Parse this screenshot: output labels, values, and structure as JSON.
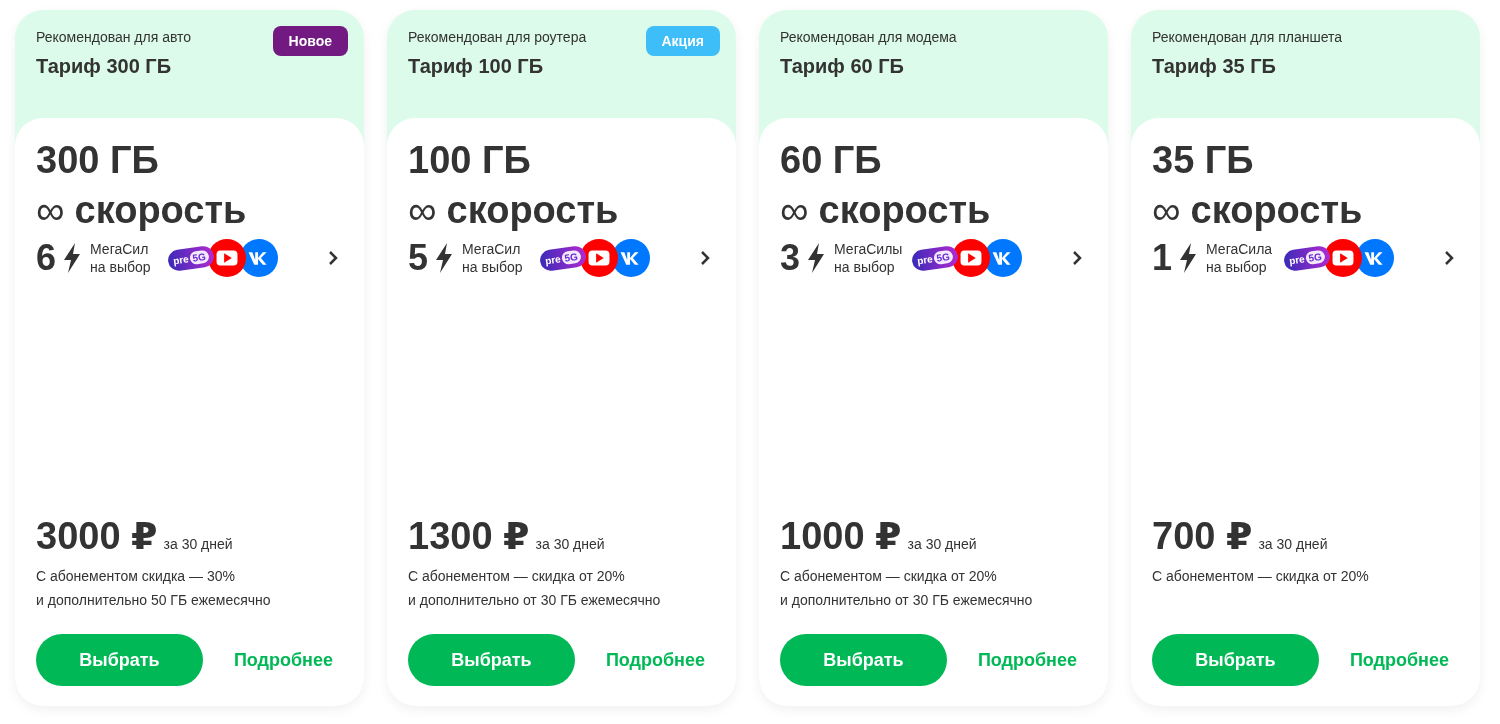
{
  "cards": [
    {
      "recommendation": "Рекомендован для авто",
      "title": "Тариф 300 ГБ",
      "badge": {
        "label": "Новое",
        "color": "#731982"
      },
      "volume": "300 ГБ",
      "infinity": "∞",
      "speed": "скорость",
      "megasily_count": "6",
      "megasily_label": [
        "МегаСил",
        "на выбор"
      ],
      "pill_text": [
        "pre",
        "5G"
      ],
      "price": "3000 ₽",
      "period": "за 30 дней",
      "notes": [
        "С абонементом скидка — 30%",
        "и дополнительно 50 ГБ ежемесячно"
      ],
      "choose": "Выбрать",
      "more": "Подробнее"
    },
    {
      "recommendation": "Рекомендован для роутера",
      "title": "Тариф 100 ГБ",
      "badge": {
        "label": "Акция",
        "color": "#3ebef8"
      },
      "volume": "100 ГБ",
      "infinity": "∞",
      "speed": "скорость",
      "megasily_count": "5",
      "megasily_label": [
        "МегаСил",
        "на выбор"
      ],
      "pill_text": [
        "pre",
        "5G"
      ],
      "price": "1300 ₽",
      "period": "за 30 дней",
      "notes": [
        "С абонементом — скидка от 20%",
        "и дополнительно от 30 ГБ ежемесячно"
      ],
      "choose": "Выбрать",
      "more": "Подробнее"
    },
    {
      "recommendation": "Рекомендован для модема",
      "title": "Тариф 60 ГБ",
      "volume": "60 ГБ",
      "infinity": "∞",
      "speed": "скорость",
      "megasily_count": "3",
      "megasily_label": [
        "МегаСилы",
        "на выбор"
      ],
      "pill_text": [
        "pre",
        "5G"
      ],
      "price": "1000 ₽",
      "period": "за 30 дней",
      "notes": [
        "С абонементом — скидка от 20%",
        "и дополнительно от 30 ГБ ежемесячно"
      ],
      "choose": "Выбрать",
      "more": "Подробнее"
    },
    {
      "recommendation": "Рекомендован для планшета",
      "title": "Тариф 35 ГБ",
      "volume": "35 ГБ",
      "infinity": "∞",
      "speed": "скорость",
      "megasily_count": "1",
      "megasily_label": [
        "МегаСила",
        "на выбор"
      ],
      "pill_text": [
        "pre",
        "5G"
      ],
      "price": "700 ₽",
      "period": "за 30 дней",
      "notes": [
        "С абонементом — скидка от 20%"
      ],
      "choose": "Выбрать",
      "more": "Подробнее"
    }
  ]
}
